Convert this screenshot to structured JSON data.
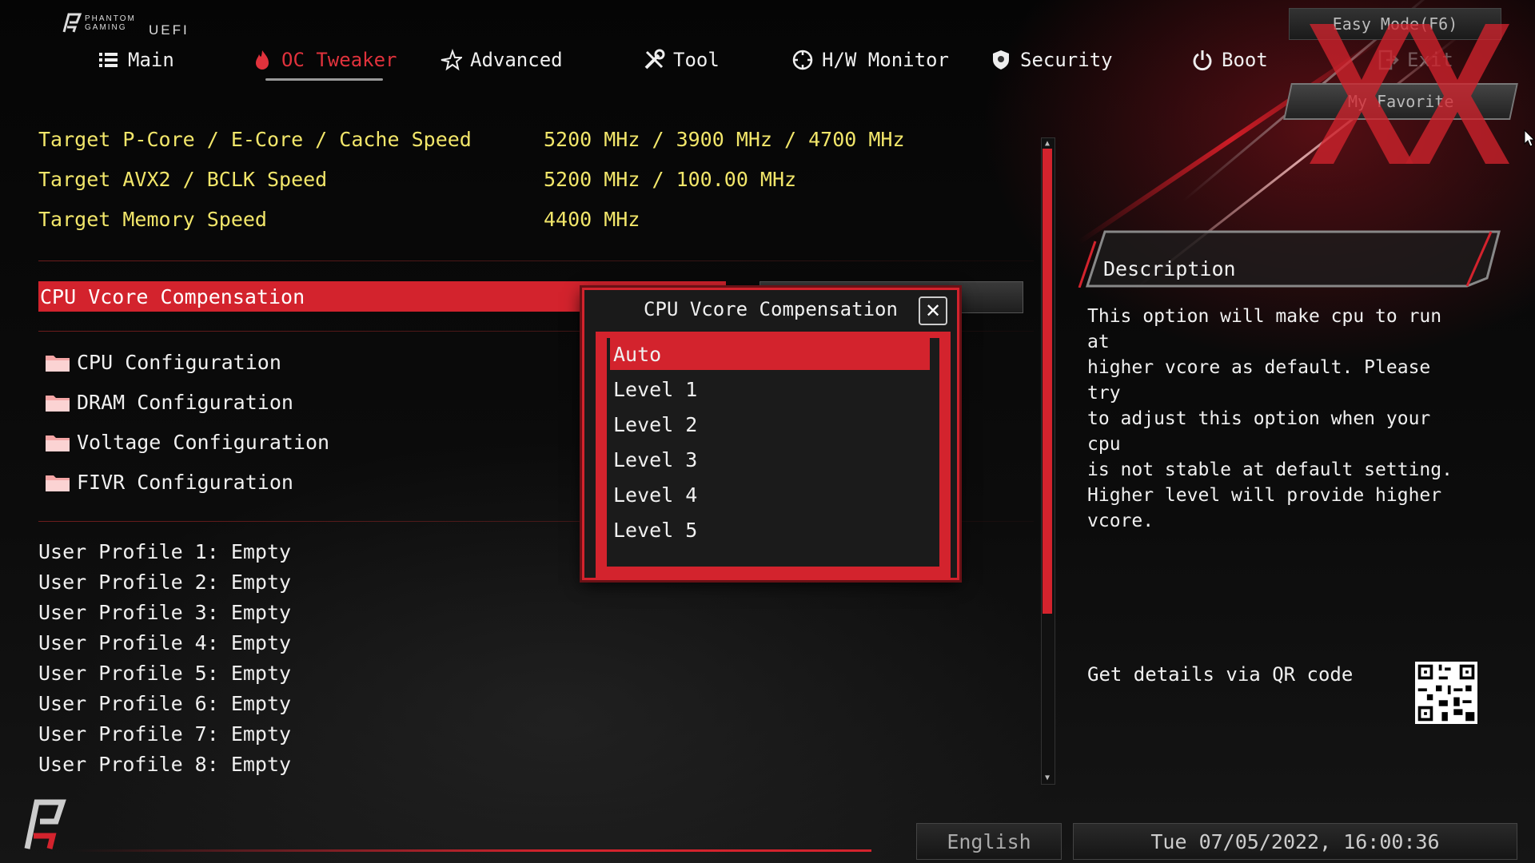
{
  "header": {
    "brand": "PHANTOM\nGAMING",
    "uefi": "UEFI",
    "easy_mode": "Easy Mode(F6)",
    "my_favorite": "My Favorite",
    "tabs": [
      {
        "label": "Main",
        "icon": "list-icon"
      },
      {
        "label": "OC Tweaker",
        "icon": "flame-icon",
        "active": true
      },
      {
        "label": "Advanced",
        "icon": "star-icon"
      },
      {
        "label": "Tool",
        "icon": "tools-icon"
      },
      {
        "label": "H/W Monitor",
        "icon": "gauge-icon"
      },
      {
        "label": "Security",
        "icon": "shield-icon"
      },
      {
        "label": "Boot",
        "icon": "power-icon"
      },
      {
        "label": "Exit",
        "icon": "exit-icon"
      }
    ]
  },
  "main": {
    "info": [
      {
        "label": "Target P-Core / E-Core / Cache Speed",
        "value": "5200 MHz / 3900 MHz / 4700 MHz"
      },
      {
        "label": "Target AVX2 / BCLK Speed",
        "value": "5200 MHz / 100.00 MHz"
      },
      {
        "label": "Target Memory Speed",
        "value": "4400 MHz"
      }
    ],
    "selected_item": {
      "label": "CPU Vcore Compensation",
      "value": "Auto"
    },
    "submenus": [
      {
        "label": "CPU Configuration"
      },
      {
        "label": "DRAM Configuration"
      },
      {
        "label": "Voltage Configuration"
      },
      {
        "label": "FIVR Configuration"
      }
    ],
    "profiles": [
      "User Profile 1: Empty",
      "User Profile 2: Empty",
      "User Profile 3: Empty",
      "User Profile 4: Empty",
      "User Profile 5: Empty",
      "User Profile 6: Empty",
      "User Profile 7: Empty",
      "User Profile 8: Empty"
    ]
  },
  "modal": {
    "title": "CPU Vcore Compensation",
    "close_symbol": "✕",
    "options": [
      "Auto",
      "Level 1",
      "Level 2",
      "Level 3",
      "Level 4",
      "Level 5"
    ],
    "selected_index": 0
  },
  "description": {
    "title": "Description",
    "text": "This option will make cpu to run at\nhigher vcore as default. Please try\nto adjust this option when your cpu\nis not stable at default setting.\nHigher level will provide higher\nvcore.",
    "qr_label": "Get details via QR code"
  },
  "footer": {
    "language": "English",
    "datetime": "Tue 07/05/2022, 16:00:36"
  },
  "colors": {
    "accent": "#d3232d",
    "info_text": "#f2e66a"
  }
}
